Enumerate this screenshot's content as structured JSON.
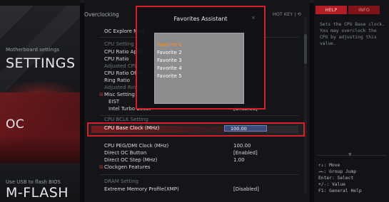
{
  "rail": {
    "settings_small": "Motherboard settings",
    "settings_big": "SETTINGS",
    "oc_big": "OC",
    "mflash_small": "Use USB to flash BIOS",
    "mflash_big": "M-FLASH"
  },
  "center": {
    "section_title": "Overclocking",
    "hotkey": "HOT KEY  |  ⟲",
    "items": [
      {
        "label": "OC Explore Mod"
      },
      {
        "label": "CPU Setting"
      },
      {
        "label": "CPU Ratio Apply"
      },
      {
        "label": "CPU Ratio"
      },
      {
        "label": "Adjusted CPU F"
      },
      {
        "label": "CPU Ratio Offse"
      },
      {
        "label": "Ring Ratio"
      },
      {
        "label": "Adjusted Ring F"
      },
      {
        "label": "Misc Setting"
      },
      {
        "label": "EIST"
      },
      {
        "label": "Intel Turbo Boost"
      },
      {
        "label": "CPU BCLK Setting"
      },
      {
        "label": "CPU PEG/DMI Clock (MHz)"
      },
      {
        "label": "Direct OC Button"
      },
      {
        "label": "Direct OC Step (MHz)"
      },
      {
        "label": "Clockgen Features"
      },
      {
        "label": "DRAM Setting"
      },
      {
        "label": "Extreme Memory Profile(XMP)"
      }
    ],
    "values": {
      "cpu_ratio_apply": "]",
      "eist": "]",
      "intel_turbo_boost": "[Enabled]",
      "peg_dmi": "100.00",
      "direct_oc_button": "[Enabled]",
      "direct_oc_step": "1.00",
      "xmp": "[Disabled]"
    },
    "selected": {
      "label": "CPU Base Clock (MHz)",
      "value": "100.00"
    }
  },
  "favorites": {
    "title": "Favorites Assistant",
    "close": "×",
    "items": [
      "Favorite 1",
      "Favorite 2",
      "Favorite 3",
      "Favorite 4",
      "Favorite 5"
    ]
  },
  "help": {
    "tab_help": "HELP",
    "tab_info": "INFO",
    "text": "Sets the CPU Base clock. You may overclock the CPU by adjusting this value.",
    "keys": [
      "↑↓: Move",
      "→←: Group Jump",
      "Enter: Select",
      "+/-: Value",
      "F1: General Help"
    ]
  },
  "colors": {
    "accent": "#d71f2a",
    "favorite_active": "#ff8c1a",
    "value_box": "#3b4b7a"
  }
}
